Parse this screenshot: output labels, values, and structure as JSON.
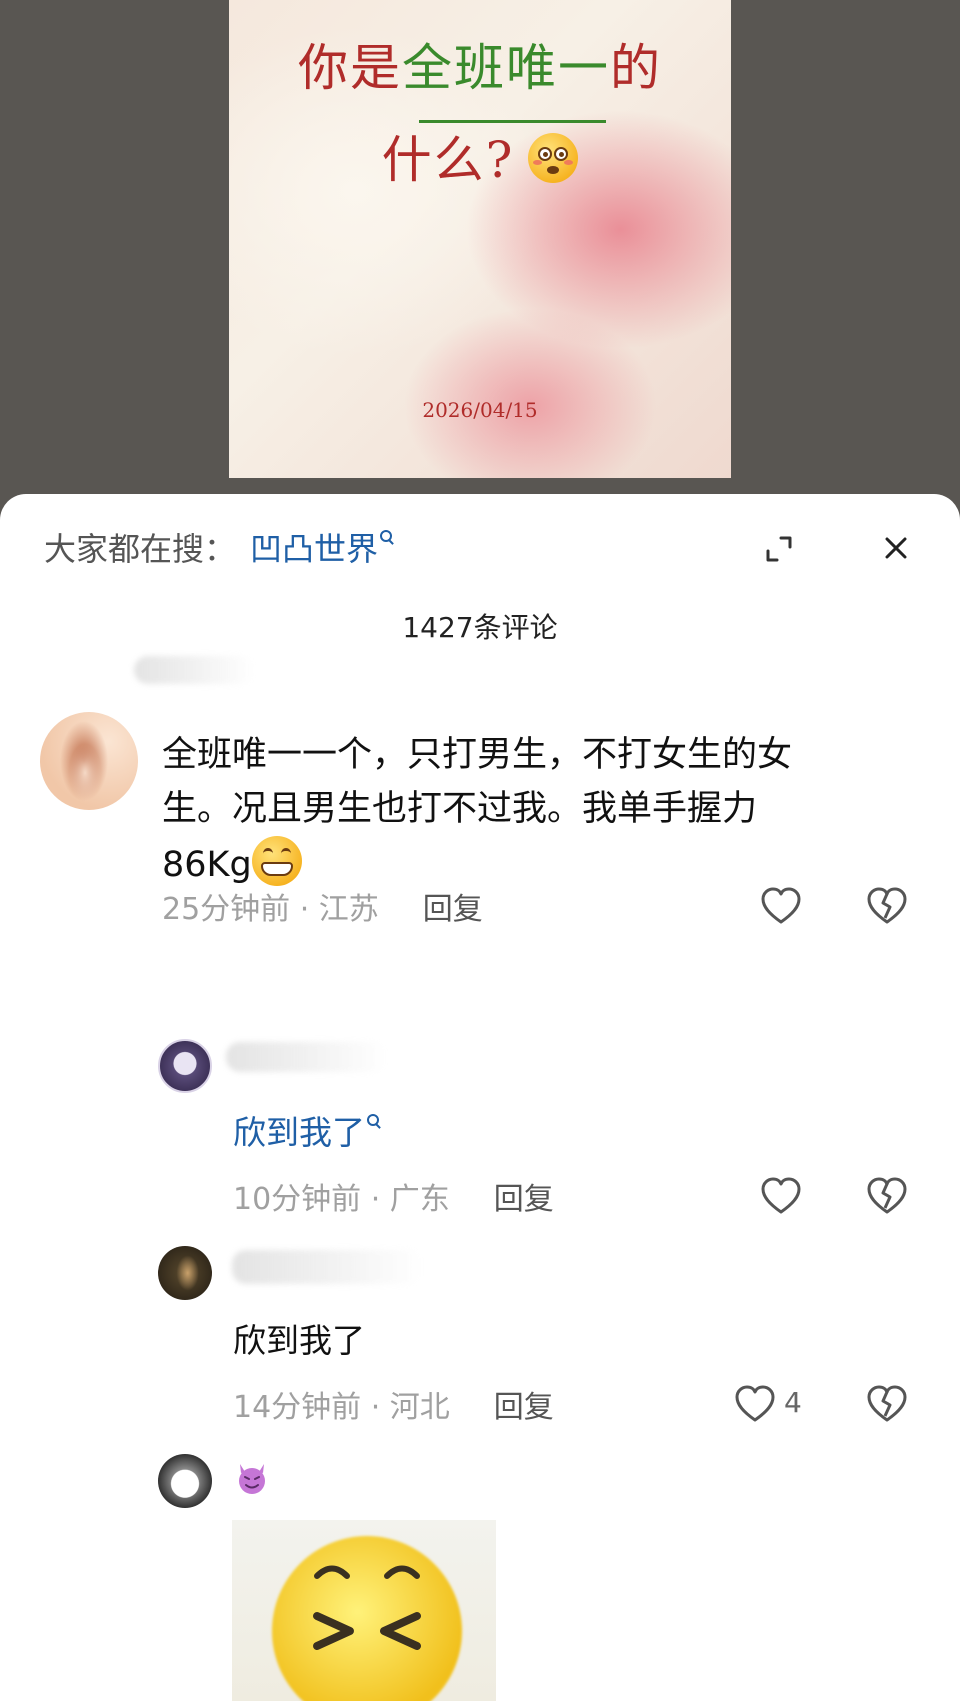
{
  "post": {
    "title_line1_a": "你是",
    "title_line1_highlight": "全班唯一",
    "title_line1_b": "的",
    "title_line2": "什么?",
    "date": "2026/04/15"
  },
  "sheet": {
    "search_label": "大家都在搜：",
    "search_keyword": "凹凸世界",
    "comment_count": "1427条评论"
  },
  "comments": [
    {
      "text_line1": "全班唯一一个，只打男生，不打女生的女",
      "text_line2": "生。况且男生也打不过我。我单手握力",
      "text_line3": "86Kg",
      "time": "25分钟前",
      "location": "江苏",
      "reply_label": "回复"
    }
  ],
  "replies": [
    {
      "text": "欣到我了",
      "linked": true,
      "time": "10分钟前",
      "location": "广东",
      "reply_label": "回复"
    },
    {
      "text": "欣到我了",
      "linked": false,
      "time": "14分钟前",
      "location": "河北",
      "reply_label": "回复",
      "like_count": "4"
    }
  ],
  "icons": {
    "heart": "heart-outline-icon",
    "dislike": "broken-heart-icon",
    "expand": "expand-icon",
    "close": "close-icon"
  },
  "colors": {
    "link_blue": "#1f5fa6",
    "title_red": "#b02c2a",
    "title_green": "#3a8a2c"
  }
}
